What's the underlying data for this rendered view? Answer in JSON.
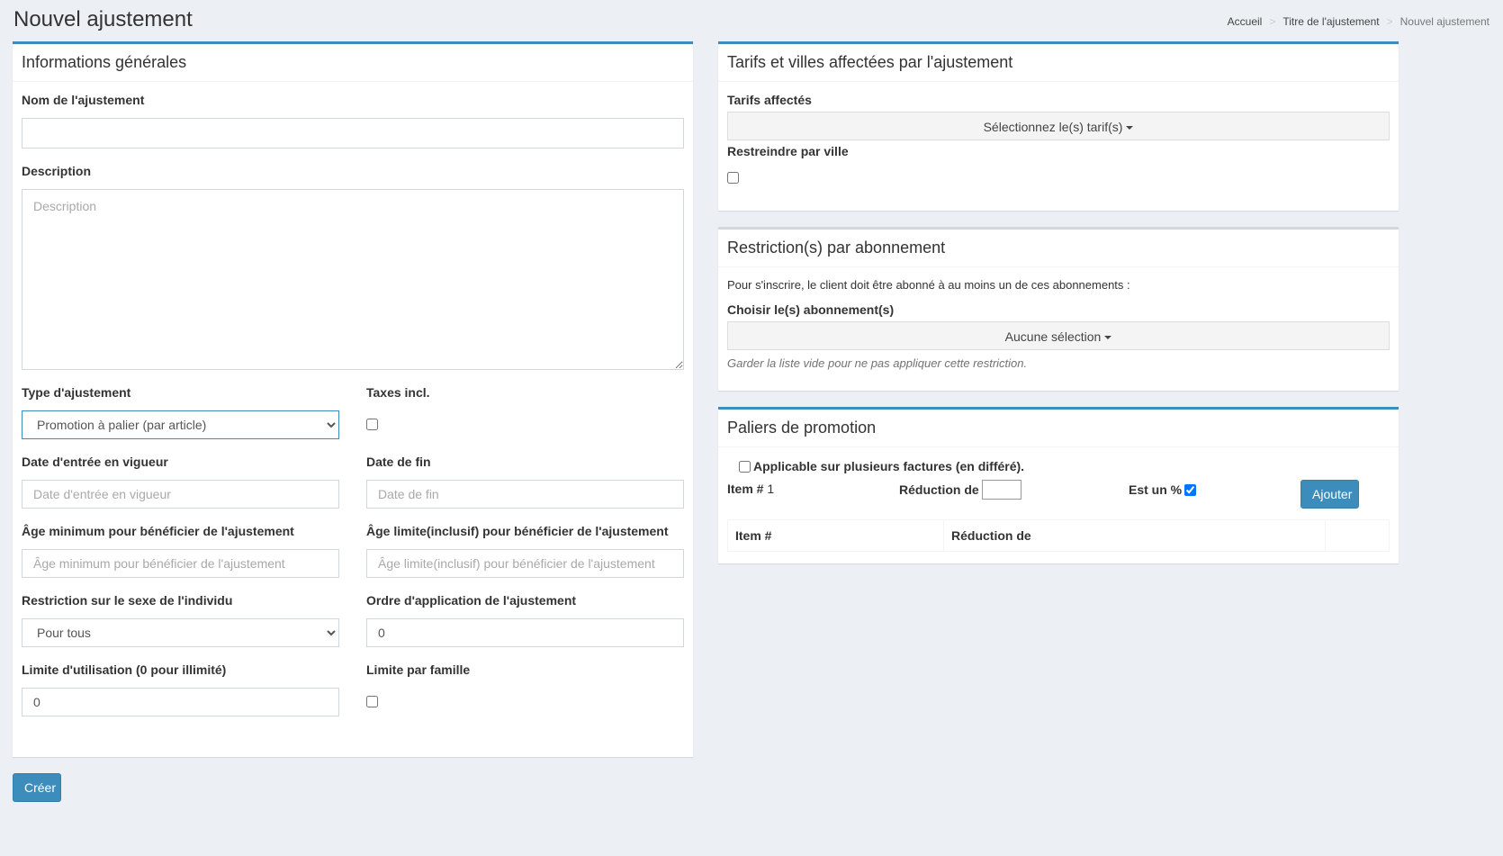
{
  "page": {
    "title": "Nouvel ajustement"
  },
  "breadcrumb": {
    "items": [
      "Accueil",
      "Titre de l'ajustement",
      "Nouvel ajustement"
    ],
    "separator": ">"
  },
  "general": {
    "header": "Informations générales",
    "name_label": "Nom de l'ajustement",
    "name_value": "",
    "description_label": "Description",
    "description_placeholder": "Description",
    "type_label": "Type d'ajustement",
    "type_value": "Promotion à palier (par article)",
    "taxes_label": "Taxes incl.",
    "start_label": "Date d'entrée en vigueur",
    "start_placeholder": "Date d'entrée en vigueur",
    "end_label": "Date de fin",
    "end_placeholder": "Date de fin",
    "min_age_label": "Âge minimum pour bénéficier de l'ajustement",
    "min_age_placeholder": "Âge minimum pour bénéficier de l'ajustement",
    "max_age_label": "Âge limite(inclusif) pour bénéficier de l'ajustement",
    "max_age_placeholder": "Âge limite(inclusif) pour bénéficier de l'ajustement",
    "sex_label": "Restriction sur le sexe de l'individu",
    "sex_value": "Pour tous",
    "order_label": "Ordre d'application de l'ajustement",
    "order_value": "0",
    "usage_label": "Limite d'utilisation (0 pour illimité)",
    "usage_value": "0",
    "family_label": "Limite par famille"
  },
  "tarifs": {
    "header": "Tarifs et villes affectées par l'ajustement",
    "tarifs_label": "Tarifs affectés",
    "tarifs_button": "Sélectionnez le(s) tarif(s)",
    "city_label": "Restreindre par ville"
  },
  "subscriptions": {
    "header": "Restriction(s) par abonnement",
    "intro": "Pour s'inscrire, le client doit être abonné à au moins un de ces abonnements :",
    "choose_label": "Choisir le(s) abonnement(s)",
    "choose_button": "Aucune sélection",
    "help": "Garder la liste vide pour ne pas appliquer cette restriction."
  },
  "tiers": {
    "header": "Paliers de promotion",
    "multi_label": "Applicable sur plusieurs factures (en différé).",
    "item_label": "Item #",
    "item_value": "1",
    "reduction_label": "Réduction de",
    "percent_label": "Est un %",
    "add_button": "Ajouter",
    "columns": [
      "Item #",
      "Réduction de",
      ""
    ]
  },
  "actions": {
    "create_button": "Créer"
  },
  "colors": {
    "accent": "#3c8dbc",
    "background": "#ecf0f5"
  }
}
